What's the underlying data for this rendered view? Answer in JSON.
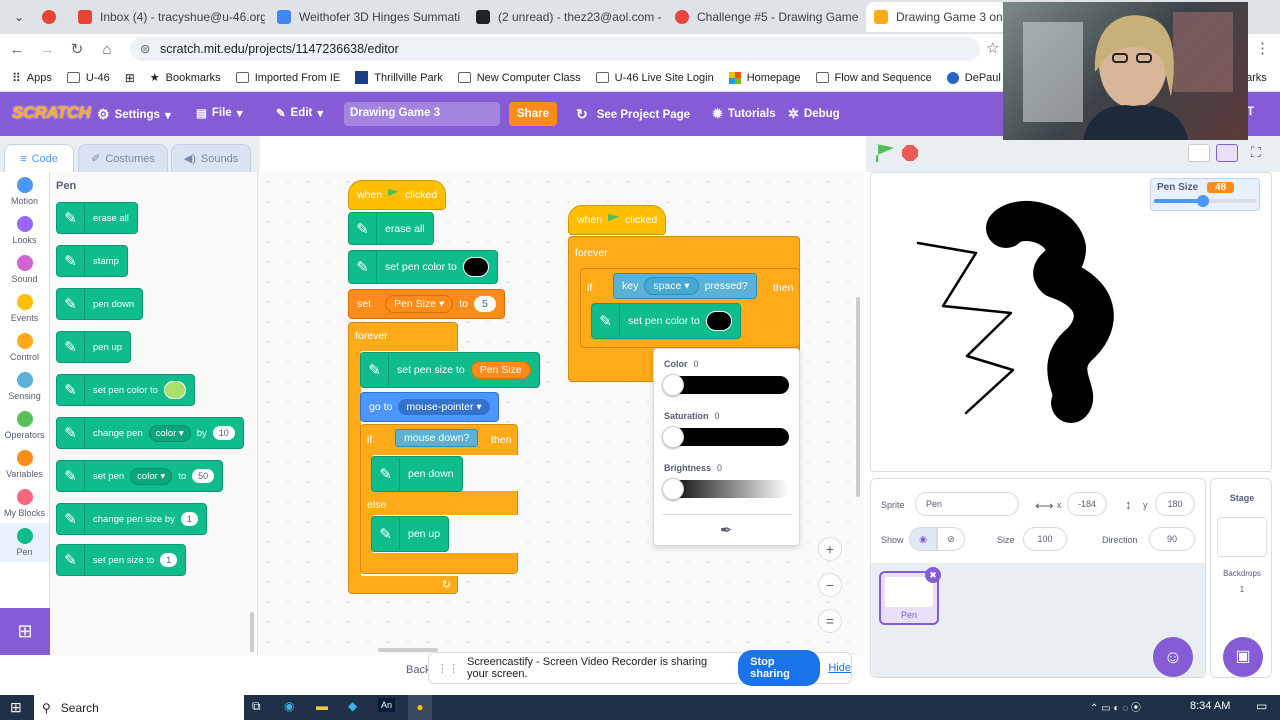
{
  "browser": {
    "tabs": [
      {
        "label": "Inbox (4) - tracyshue@u-46.org",
        "color": "#ea4335"
      },
      {
        "label": "Weithofer 3D Hinges Summati",
        "color": "#4285f4"
      },
      {
        "label": "(2 unread) - thez23@aol.com -",
        "color": "#202124"
      },
      {
        "label": "Challenge #5 - Drawing Game",
        "color": "#e8453c"
      },
      {
        "label": "Drawing Game 3 on Scrat",
        "color": "#ffab19"
      }
    ],
    "url": "scratch.mit.edu/projects/1147236638/editor",
    "bookmarks": [
      "Apps",
      "U-46",
      "Bookmarks",
      "Imported From IE",
      "Thrillville Park",
      "New Computer Class",
      "U-46 Live Site Login",
      "Homepage",
      "Flow and Sequence",
      "DePaul University C..."
    ],
    "bookmarks_tail": "arks"
  },
  "menu": {
    "logo": "SCRATCH",
    "settings": "Settings",
    "file": "File",
    "edit": "Edit",
    "project_title": "Drawing Game 3",
    "share": "Share",
    "see_project": "See Project Page",
    "tutorials": "Tutorials",
    "debug": "Debug",
    "tail": "T"
  },
  "editor_tabs": {
    "code": "Code",
    "costumes": "Costumes",
    "sounds": "Sounds"
  },
  "categories": [
    {
      "label": "Motion",
      "color": "#4c97ff"
    },
    {
      "label": "Looks",
      "color": "#9966ff"
    },
    {
      "label": "Sound",
      "color": "#cf63cf"
    },
    {
      "label": "Events",
      "color": "#ffbf00"
    },
    {
      "label": "Control",
      "color": "#ffab19"
    },
    {
      "label": "Sensing",
      "color": "#5cb1d6"
    },
    {
      "label": "Operators",
      "color": "#59c059"
    },
    {
      "label": "Variables",
      "color": "#ff8c1a"
    },
    {
      "label": "My Blocks",
      "color": "#ff6680"
    },
    {
      "label": "Pen",
      "color": "#0fbd8c"
    }
  ],
  "palette": {
    "heading": "Pen",
    "erase_all": "erase all",
    "stamp": "stamp",
    "pen_down": "pen down",
    "pen_up": "pen up",
    "set_pen_color": "set pen color to",
    "pen_color_swatch": "#a8e06a",
    "change_pen": "change pen",
    "color_dd": "color",
    "by": "by",
    "change_by_val": "10",
    "set_pen": "set pen",
    "set_pen_dd": "color",
    "to": "to",
    "set_to_val": "50",
    "change_size": "change pen size by",
    "change_size_val": "1",
    "set_size": "set pen size to",
    "set_size_val": "1"
  },
  "script1": {
    "hat": "when",
    "clicked": "clicked",
    "erase_all": "erase all",
    "set_pen_color": "set pen color to",
    "pen_swatch": "#000000",
    "set": "set",
    "var_dd": "Pen Size",
    "to": "to",
    "var_val": "5",
    "forever": "forever",
    "set_size": "set pen size to",
    "size_reporter": "Pen Size",
    "goto": "go to",
    "goto_dd": "mouse-pointer",
    "if": "if",
    "mouse_down": "mouse down?",
    "then": "then",
    "pen_down": "pen down",
    "else": "else",
    "pen_up": "pen up"
  },
  "script2": {
    "hat": "when",
    "clicked": "clicked",
    "forever": "forever",
    "if": "if",
    "key": "key",
    "key_dd": "space",
    "pressed": "pressed?",
    "then": "then",
    "set_pen_color": "set pen color to"
  },
  "color_picker": {
    "color_label": "Color",
    "color_val": "0",
    "sat_label": "Saturation",
    "sat_val": "0",
    "bright_label": "Brightness",
    "bright_val": "0"
  },
  "zoom": {
    "in": "+",
    "out": "−",
    "reset": "="
  },
  "stage": {
    "monitor_label": "Pen Size",
    "monitor_value": "48"
  },
  "sprite_info": {
    "sprite_label": "Sprite",
    "sprite_name": "Pen",
    "x_label": "x",
    "x_val": "-184",
    "y_label": "y",
    "y_val": "180",
    "show_label": "Show",
    "size_label": "Size",
    "size_val": "100",
    "direction_label": "Direction",
    "direction_val": "90",
    "thumb_label": "Pen"
  },
  "stage_pane": {
    "title": "Stage",
    "backdrops": "Backdrops",
    "count": "1"
  },
  "screencastify": {
    "back": "Back",
    "message": "Screencastify - Screen Video Recorder is sharing your screen.",
    "stop": "Stop sharing",
    "hide": "Hide"
  },
  "taskbar": {
    "search": "Search",
    "time": "8:34 AM"
  }
}
